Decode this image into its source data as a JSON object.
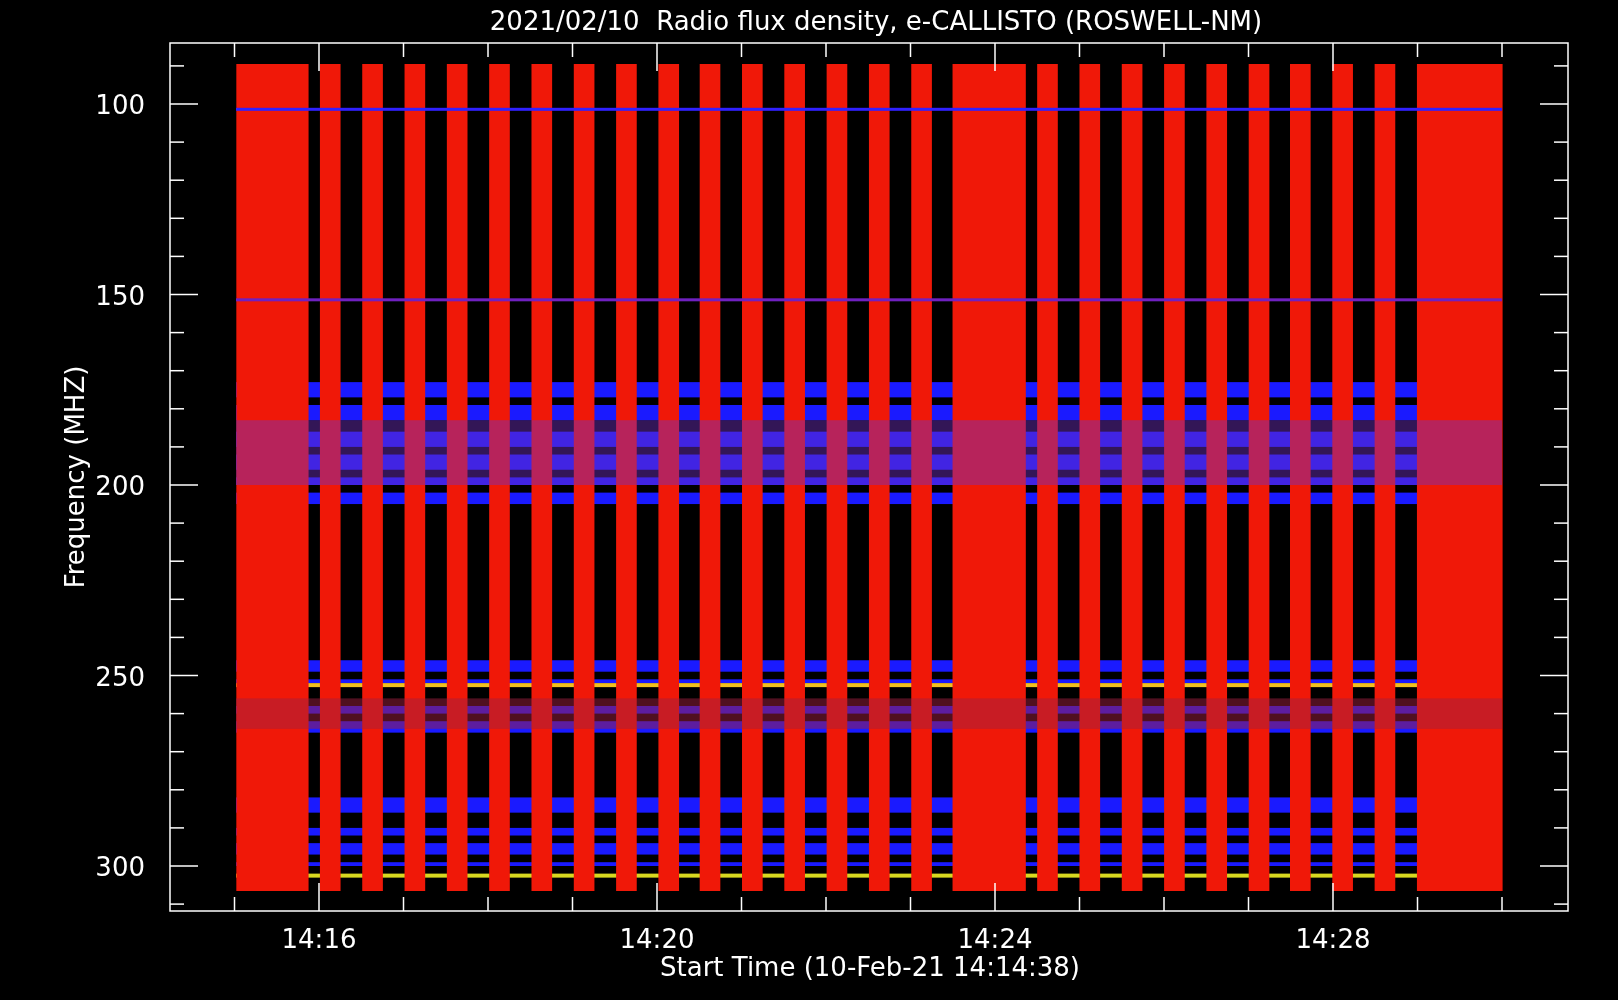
{
  "title": "2021/02/10  Radio flux density, e-CALLISTO (ROSWELL-NM)",
  "y_axis": {
    "label": "Frequency (MHZ)",
    "ticks": [
      "100",
      "150",
      "200",
      "250",
      "300"
    ]
  },
  "x_axis": {
    "label": "Start Time (10-Feb-21 14:14:38)",
    "ticks": [
      "14:16",
      "14:20",
      "14:24",
      "14:28"
    ]
  }
}
